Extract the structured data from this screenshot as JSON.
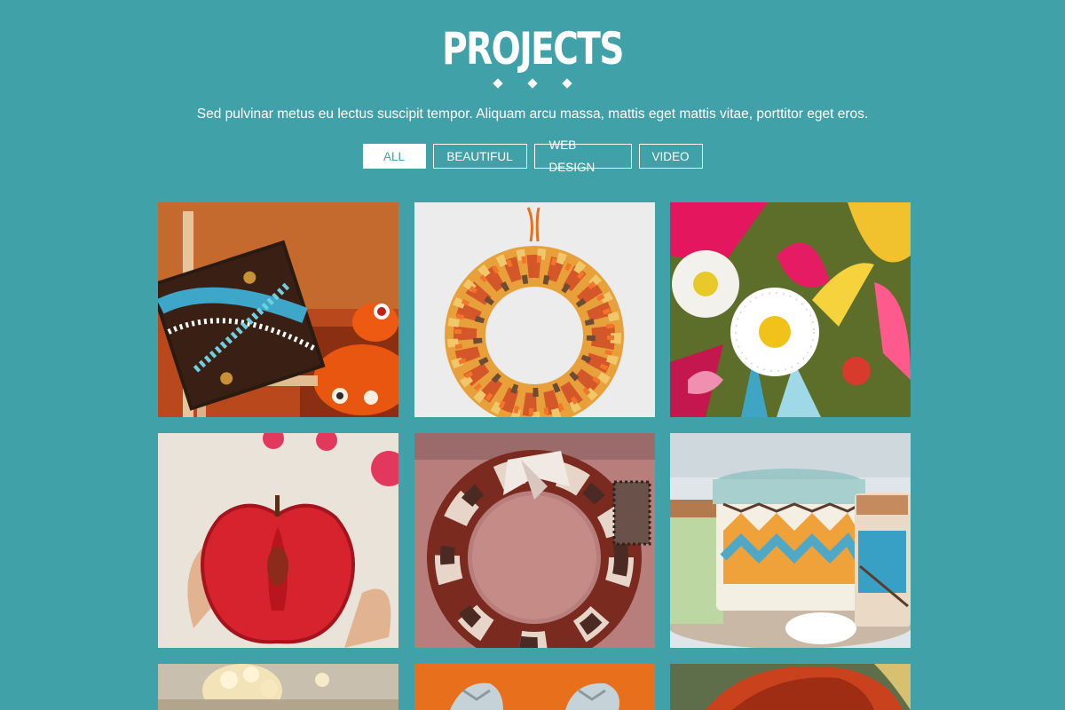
{
  "section": {
    "title": "PROJECTS",
    "subtitle": "Sed pulvinar metus eu lectus suscipit tempor. Aliquam arcu massa, mattis eget mattis vitae, porttitor eget eros."
  },
  "filters": [
    {
      "label": "ALL",
      "active": true
    },
    {
      "label": "BEAUTIFUL",
      "active": false
    },
    {
      "label": "WEB DESIGN",
      "active": false
    },
    {
      "label": "VIDEO",
      "active": false
    }
  ],
  "colors": {
    "background": "#41a1a9",
    "text": "#ffffff",
    "active_filter_text": "#41a1a9"
  },
  "projects": [
    {
      "image": "dot-painting-canvas-on-easel"
    },
    {
      "image": "fabric-scrap-wreath"
    },
    {
      "image": "paper-flowers-and-feathers"
    },
    {
      "image": "red-apple-half"
    },
    {
      "image": "necktie-wreath"
    },
    {
      "image": "patterned-toy-drums"
    },
    {
      "image": "popcorn-bowl"
    },
    {
      "image": "fabric-cat-plush"
    },
    {
      "image": "red-hair-portrait"
    }
  ]
}
